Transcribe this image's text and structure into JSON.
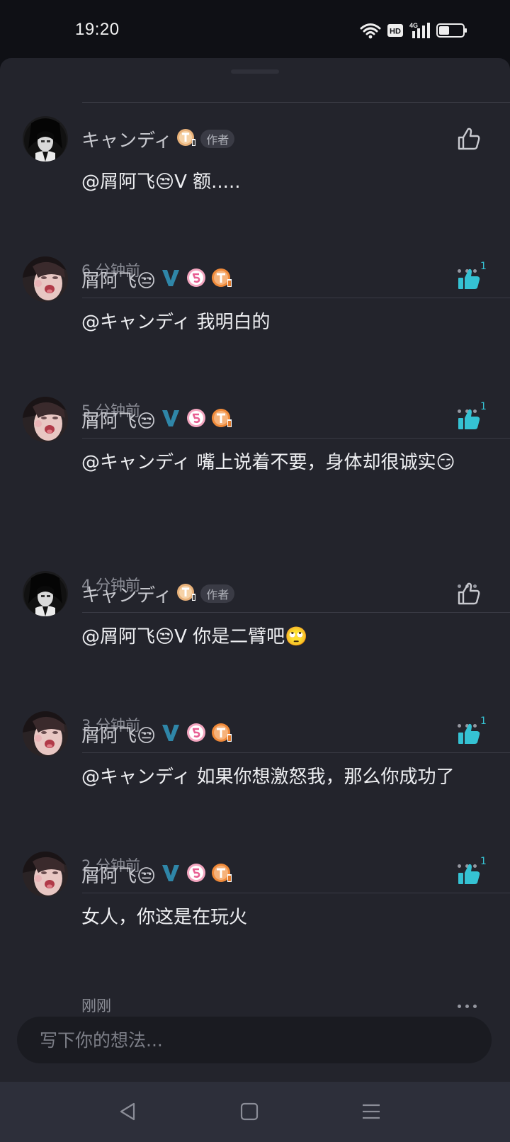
{
  "status_bar": {
    "time": "19:20",
    "icons": [
      "wifi-icon",
      "hd-icon",
      "signal-4g-icon",
      "battery-icon"
    ],
    "hd_label": "HD",
    "network_label": "4G"
  },
  "colors": {
    "background": "#23242c",
    "accent_like": "#35c2d3",
    "verified": "#2f86a8",
    "muted_text": "#8c8e97"
  },
  "comments": [
    {
      "name": "キャンディ",
      "author_badge": "作者",
      "text": "@屑阿飞😒V 额.....",
      "time": "6 分钟前",
      "liked": false,
      "like_count": ""
    },
    {
      "name": "屑阿飞😒",
      "author_badge": "",
      "text": "@キャンディ 我明白的",
      "time": "5 分钟前",
      "liked": true,
      "like_count": "1"
    },
    {
      "name": "屑阿飞😒",
      "author_badge": "",
      "text": "@キャンディ 嘴上说着不要，身体却很诚实😏",
      "time": "4 分钟前",
      "liked": true,
      "like_count": "1"
    },
    {
      "name": "キャンディ",
      "author_badge": "作者",
      "text": "@屑阿飞😒V 你是二臂吧🙄",
      "time": "3 分钟前",
      "liked": false,
      "like_count": ""
    },
    {
      "name": "屑阿飞😒",
      "author_badge": "",
      "text": "@キャンディ 如果你想激怒我，那么你成功了",
      "time": "2 分钟前",
      "liked": true,
      "like_count": "1"
    },
    {
      "name": "屑阿飞😒",
      "author_badge": "",
      "text": "女人，你这是在玩火",
      "time": "刚刚",
      "liked": true,
      "like_count": "1"
    }
  ],
  "composer": {
    "placeholder": "写下你的想法..."
  },
  "nav": [
    "back-icon",
    "home-icon",
    "recents-icon"
  ]
}
